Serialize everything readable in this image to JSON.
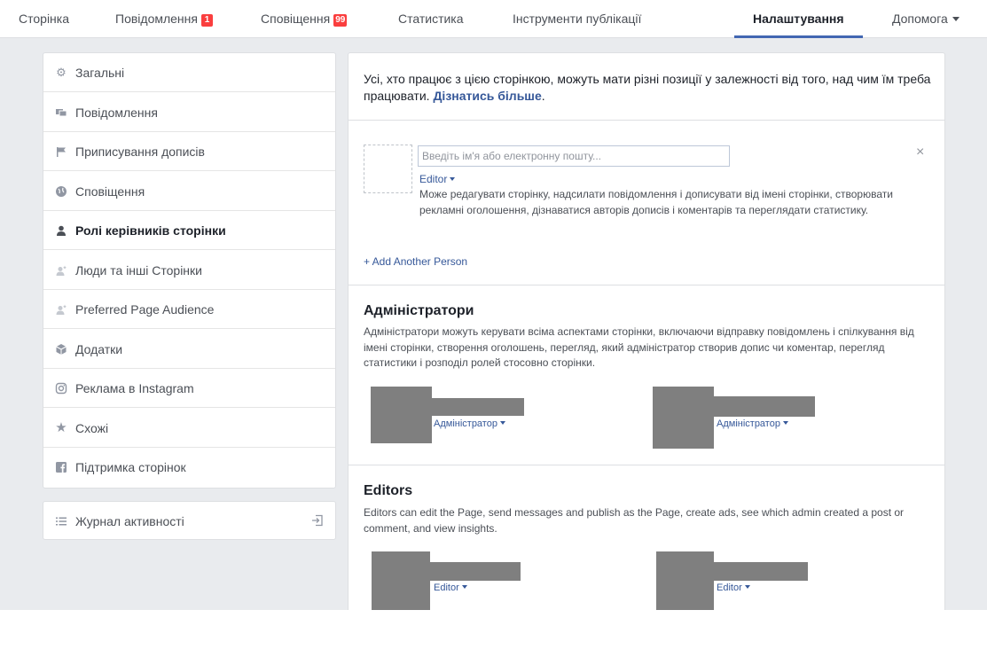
{
  "nav": {
    "items": [
      {
        "label": "Сторінка"
      },
      {
        "label": "Повідомлення",
        "badge": "1"
      },
      {
        "label": "Сповіщення",
        "badge": "99"
      },
      {
        "label": "Статистика"
      },
      {
        "label": "Інструменти публікації"
      },
      {
        "label": "Налаштування",
        "active": true
      },
      {
        "label": "Допомога"
      }
    ]
  },
  "sidebar": {
    "items": [
      {
        "label": "Загальні",
        "icon": "gear-icon"
      },
      {
        "label": "Повідомлення",
        "icon": "chat-icon"
      },
      {
        "label": "Приписування дописів",
        "icon": "flag-icon"
      },
      {
        "label": "Сповіщення",
        "icon": "globe-icon"
      },
      {
        "label": "Ролі керівників сторінки",
        "icon": "person-icon",
        "active": true
      },
      {
        "label": "Люди та інші Сторінки",
        "icon": "person-star-icon"
      },
      {
        "label": "Preferred Page Audience",
        "icon": "person-star-icon"
      },
      {
        "label": "Додатки",
        "icon": "cube-icon"
      },
      {
        "label": "Реклама в Instagram",
        "icon": "instagram-icon"
      },
      {
        "label": "Схожі",
        "icon": "star-icon"
      },
      {
        "label": "Підтримка сторінок",
        "icon": "facebook-icon"
      }
    ],
    "activity_log": {
      "label": "Журнал активності",
      "icon": "list-icon"
    }
  },
  "main": {
    "intro_text": "Усі, хто працює з цією сторінкою, можуть мати різні позиції у залежності від того, над чим їм треба працювати. ",
    "intro_link": "Дізнатись більше",
    "intro_end": ".",
    "assign": {
      "placeholder": "Введіть ім'я або електронну пошту...",
      "role": "Editor",
      "role_desc": "Може редагувати сторінку, надсилати повідомлення і дописувати від імені сторінки, створювати рекламні оголошення, дізнаватися авторів дописів і коментарів та переглядати статистику.",
      "add_another": "+ Add Another Person",
      "close": "×"
    },
    "admins": {
      "title": "Адміністратори",
      "desc": "Адміністратори можуть керувати всіма аспектами сторінки, включаючи відправку повідомлень і спілкування від імені сторінки, створення оголошень, перегляд, який адміністратор створив допис чи коментар, перегляд статистики і розподіл ролей стосовно сторінки.",
      "members": [
        {
          "role": "Адміністратор"
        },
        {
          "role": "Адміністратор"
        }
      ]
    },
    "editors": {
      "title": "Editors",
      "desc": "Editors can edit the Page, send messages and publish as the Page, create ads, see which admin created a post or comment, and view insights.",
      "members": [
        {
          "role": "Editor"
        },
        {
          "role": "Editor"
        }
      ]
    }
  }
}
